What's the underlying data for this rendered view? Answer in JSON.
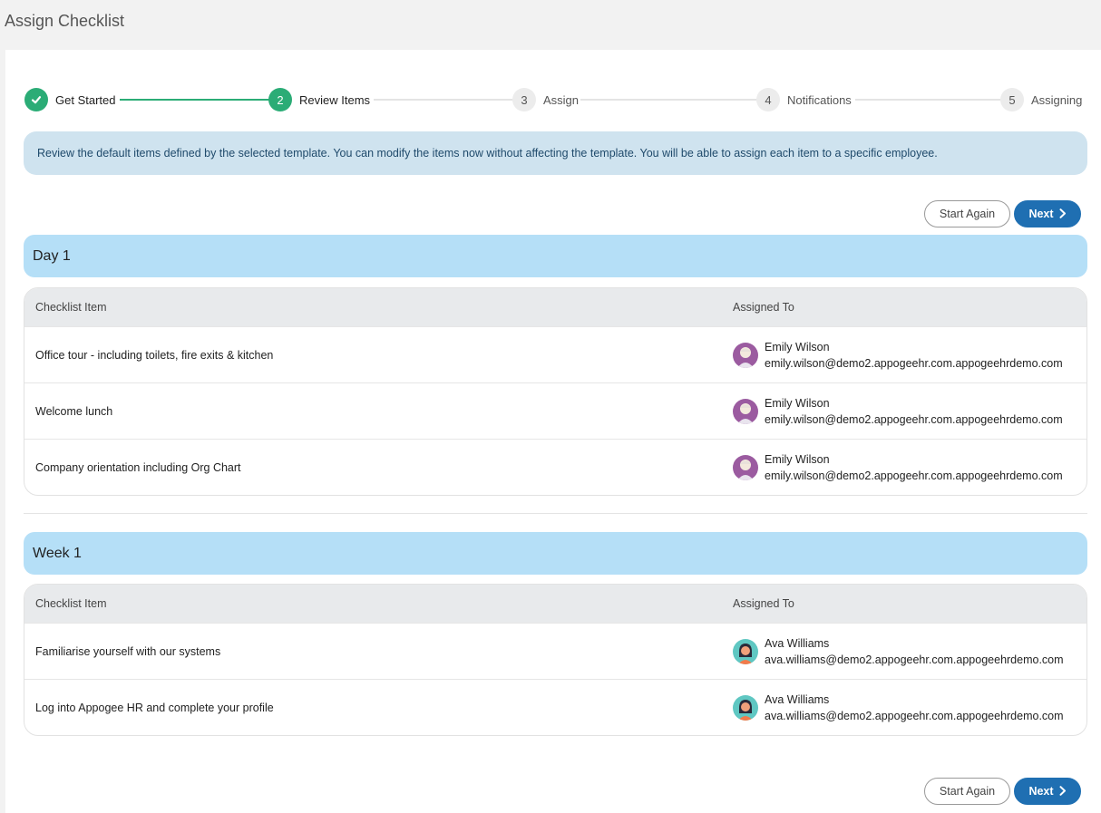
{
  "title": "Assign Checklist",
  "stepper": [
    {
      "num": "",
      "label": "Get Started",
      "state": "done"
    },
    {
      "num": "2",
      "label": "Review Items",
      "state": "active"
    },
    {
      "num": "3",
      "label": "Assign",
      "state": "pending"
    },
    {
      "num": "4",
      "label": "Notifications",
      "state": "pending"
    },
    {
      "num": "5",
      "label": "Assigning",
      "state": "pending"
    }
  ],
  "info": "Review the default items defined by the selected template. You can modify the items now without affecting the template. You will be able to assign each item to a specific employee.",
  "buttons": {
    "start_again": "Start Again",
    "next": "Next"
  },
  "columns": {
    "item": "Checklist Item",
    "assigned": "Assigned To"
  },
  "sections": [
    {
      "title": "Day 1",
      "rows": [
        {
          "item": "Office tour - including toilets, fire exits & kitchen",
          "name": "Emily Wilson",
          "email": "emily.wilson@demo2.appogeehr.com.appogeehrdemo.com"
        },
        {
          "item": "Welcome lunch",
          "name": "Emily Wilson",
          "email": "emily.wilson@demo2.appogeehr.com.appogeehrdemo.com"
        },
        {
          "item": "Company orientation including Org Chart",
          "name": "Emily Wilson",
          "email": "emily.wilson@demo2.appogeehr.com.appogeehrdemo.com"
        }
      ]
    },
    {
      "title": "Week 1",
      "rows": [
        {
          "item": "Familiarise yourself with our systems",
          "name": "Ava Williams",
          "email": "ava.williams@demo2.appogeehr.com.appogeehrdemo.com"
        },
        {
          "item": "Log into Appogee HR and complete your profile",
          "name": "Ava Williams",
          "email": "ava.williams@demo2.appogeehr.com.appogeehrdemo.com"
        }
      ]
    }
  ],
  "colors": {
    "accent_green": "#2bac76",
    "primary_blue": "#1f6fb2",
    "section_blue": "#b5dff7",
    "info_blue": "#cfe3ef"
  }
}
